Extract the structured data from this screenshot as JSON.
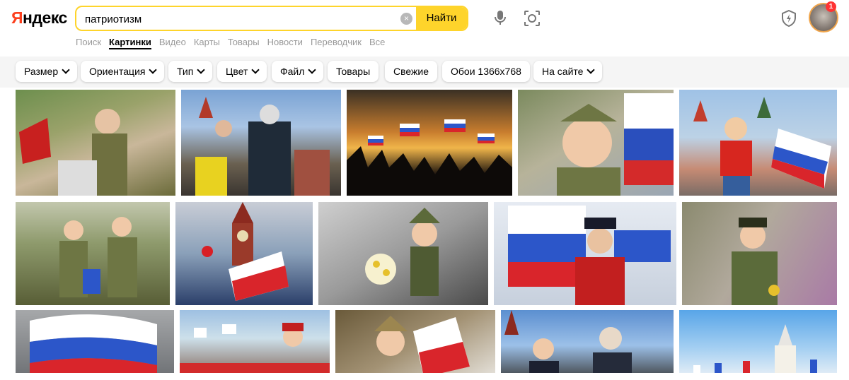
{
  "logo": {
    "red": "Я",
    "black": "ндекс"
  },
  "search": {
    "query": "патриотизм",
    "button": "Найти",
    "clear_glyph": "×"
  },
  "icons": {
    "mic": "microphone-icon",
    "lens": "camera-lens-icon",
    "shield": "shield-icon",
    "avatar": "user-avatar"
  },
  "notification": {
    "count": "1"
  },
  "nav": [
    "Поиск",
    "Картинки",
    "Видео",
    "Карты",
    "Товары",
    "Новости",
    "Переводчик",
    "Все"
  ],
  "filters": {
    "size": "Размер",
    "orientation": "Ориентация",
    "type": "Тип",
    "color": "Цвет",
    "file": "Файл",
    "goods": "Товары",
    "fresh": "Свежие",
    "wallpaper": "Обои 1366x768",
    "on_site": "На сайте"
  },
  "colors": {
    "accent": "#fed42b",
    "brand_red": "#fc3f1d"
  }
}
